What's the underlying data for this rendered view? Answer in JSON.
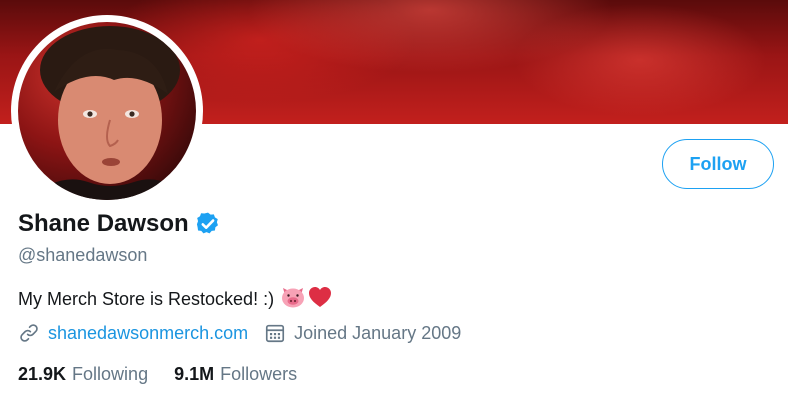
{
  "profile": {
    "display_name": "Shane Dawson",
    "handle": "@shanedawson",
    "verified": true,
    "bio": "My Merch Store is Restocked! :)",
    "bio_emojis": [
      "pig-face",
      "red-heart"
    ],
    "website": "shanedawsonmerch.com",
    "joined": "Joined January 2009",
    "follow_label": "Follow"
  },
  "stats": {
    "following_count": "21.9K",
    "following_label": "Following",
    "followers_count": "9.1M",
    "followers_label": "Followers"
  },
  "colors": {
    "accent": "#1da1f2",
    "link": "#1b95e0",
    "banner": "#b01c1a",
    "secondary_text": "#657786"
  },
  "icons": {
    "verified": "verified-badge-icon",
    "link": "link-icon",
    "calendar": "calendar-icon"
  }
}
